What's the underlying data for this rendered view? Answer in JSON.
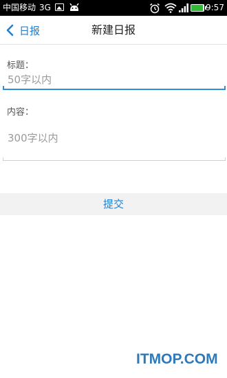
{
  "status_bar": {
    "carrier": "中国移动",
    "network": "3G",
    "time": "9:57",
    "battery_level": 0.95,
    "battery_color": "#34b837"
  },
  "header": {
    "back_label": "日报",
    "title": "新建日报",
    "accent_color": "#1f7fd1"
  },
  "form": {
    "title_label": "标题：",
    "title_placeholder": "50字以内",
    "title_value": "",
    "content_label": "内容：",
    "content_placeholder": "300字以内",
    "content_value": ""
  },
  "submit_label": "提交",
  "watermark": "ITMOP.COM"
}
